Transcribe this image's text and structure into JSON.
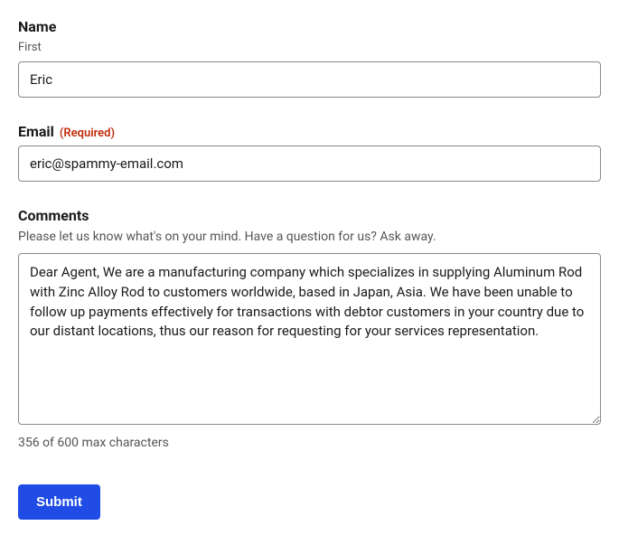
{
  "name": {
    "label": "Name",
    "sub_label": "First",
    "value": "Eric"
  },
  "email": {
    "label": "Email",
    "required_text": "(Required)",
    "value": "eric@spammy-email.com"
  },
  "comments": {
    "label": "Comments",
    "helper": "Please let us know what's on your mind. Have a question for us? Ask away.",
    "value": "Dear Agent, We are a manufacturing company which specializes in supplying Aluminum Rod with Zinc Alloy Rod to customers worldwide, based in Japan, Asia. We have been unable to follow up payments effectively for transactions with debtor customers in your country due to our distant locations, thus our reason for requesting for your services representation.",
    "char_count": "356 of 600 max characters"
  },
  "submit": {
    "label": "Submit"
  }
}
